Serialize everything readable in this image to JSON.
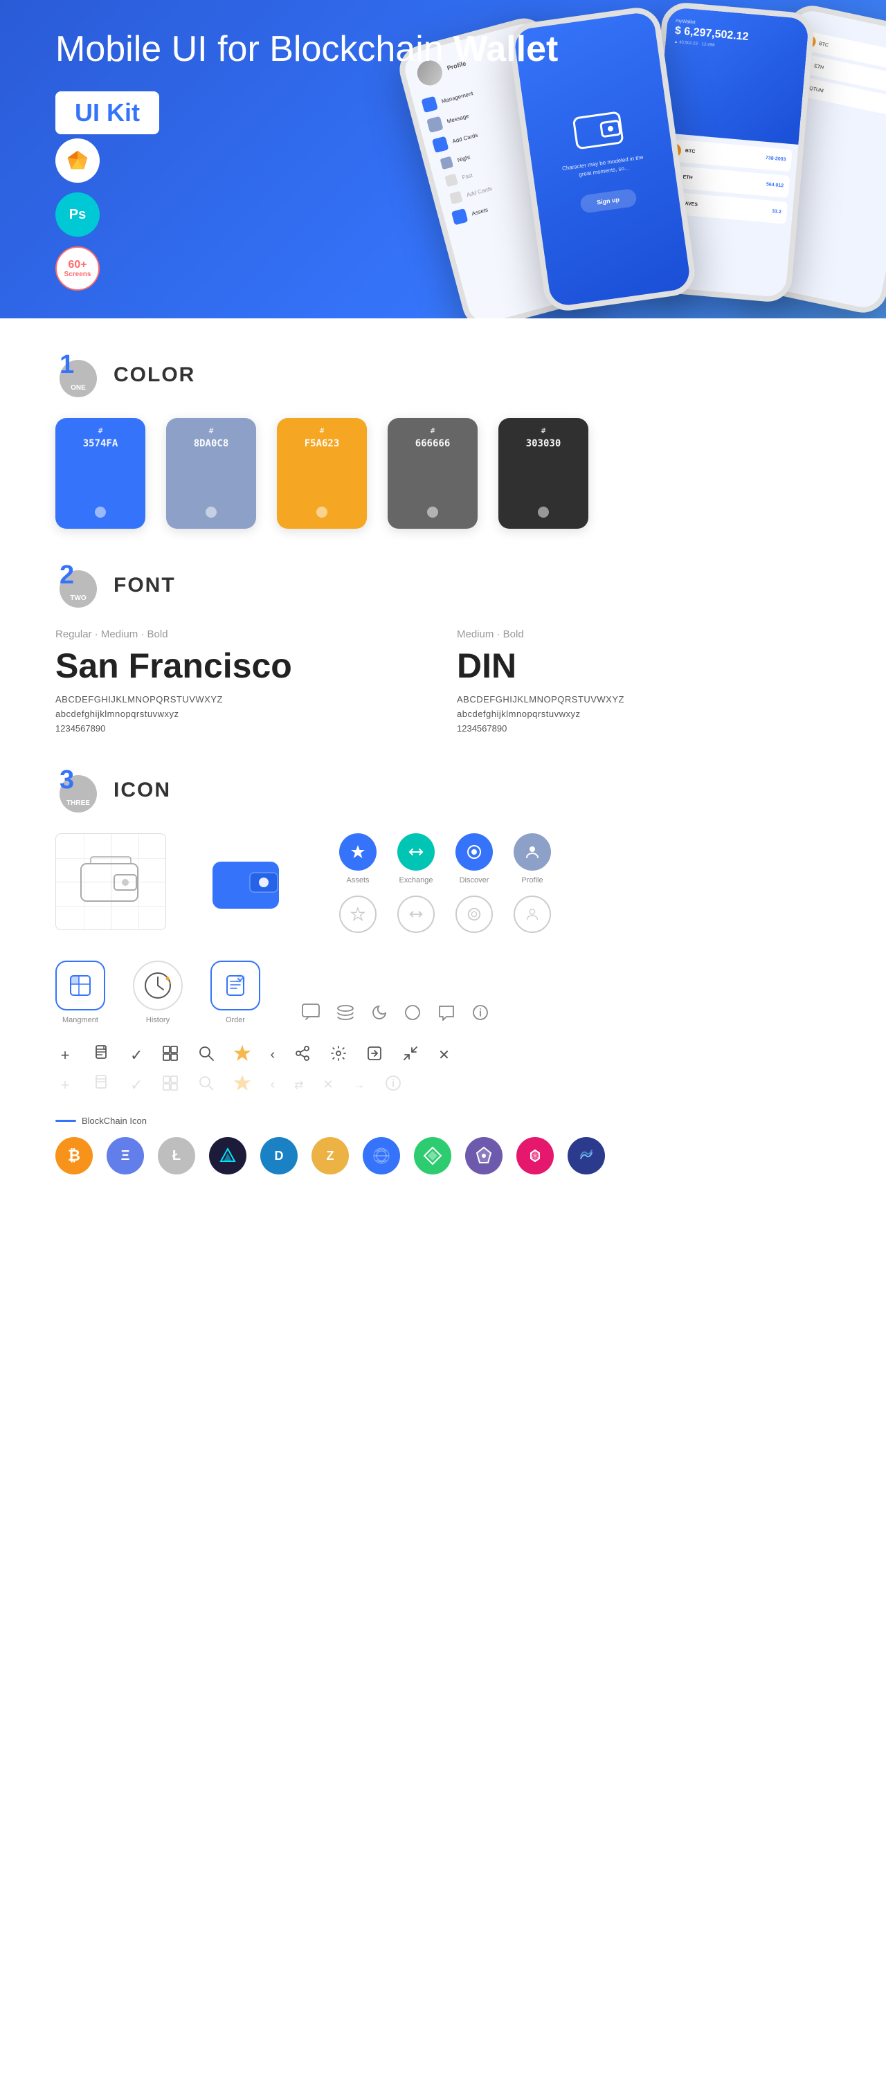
{
  "hero": {
    "title_normal": "Mobile UI for Blockchain ",
    "title_bold": "Wallet",
    "badge": "UI Kit",
    "sketch_label": "Sketch",
    "ps_label": "Ps",
    "screens_label": "60+\nScreens"
  },
  "sections": {
    "color": {
      "number": "1",
      "word": "ONE",
      "title": "COLOR",
      "swatches": [
        {
          "hex": "#3574FA",
          "code": "#",
          "value": "3574FA",
          "bg": "#3574FA"
        },
        {
          "hex": "#8DA0C8",
          "code": "#",
          "value": "8DA0C8",
          "bg": "#8DA0C8"
        },
        {
          "hex": "#F5A623",
          "code": "#",
          "value": "F5A623",
          "bg": "#F5A623"
        },
        {
          "hex": "#666666",
          "code": "#",
          "value": "666666",
          "bg": "#666666"
        },
        {
          "hex": "#303030",
          "code": "#",
          "value": "303030",
          "bg": "#303030"
        }
      ]
    },
    "font": {
      "number": "2",
      "word": "TWO",
      "title": "FONT",
      "font1": {
        "style": "Regular · Medium · Bold",
        "name": "San Francisco",
        "uppercase": "ABCDEFGHIJKLMNOPQRSTUVWXYZ",
        "lowercase": "abcdefghijklmnopqrstuvwxyz",
        "numbers": "1234567890"
      },
      "font2": {
        "style": "Medium · Bold",
        "name": "DIN",
        "uppercase": "ABCDEFGHIJKLMNOPQRSTUVWXYZ",
        "lowercase": "abcdefghijklmnopqrstuvwxyz",
        "numbers": "1234567890"
      }
    },
    "icon": {
      "number": "3",
      "word": "THREE",
      "title": "ICON",
      "nav_icons": [
        {
          "label": "Assets",
          "symbol": "◆"
        },
        {
          "label": "Exchange",
          "symbol": "⇄"
        },
        {
          "label": "Discover",
          "symbol": "●"
        },
        {
          "label": "Profile",
          "symbol": "👤"
        }
      ],
      "app_icons": [
        {
          "label": "Mangment",
          "symbol": "▤"
        },
        {
          "label": "History",
          "symbol": "🕐"
        },
        {
          "label": "Order",
          "symbol": "📋"
        }
      ],
      "tool_symbols_row1": [
        "+",
        "📋",
        "✓",
        "⊞",
        "🔍",
        "☆",
        "<",
        "≺",
        "⚙",
        "⬚",
        "⇄",
        "✕"
      ],
      "blockchain_label": "BlockChain Icon",
      "crypto_icons": [
        {
          "symbol": "₿",
          "bg": "#F7931A",
          "color": "#fff"
        },
        {
          "symbol": "Ξ",
          "bg": "#627EEA",
          "color": "#fff"
        },
        {
          "symbol": "Ł",
          "bg": "#B8B8B8",
          "color": "#fff"
        },
        {
          "symbol": "▲",
          "bg": "#1a1a2e",
          "color": "#00e5ff"
        },
        {
          "symbol": "D",
          "bg": "#1A82C4",
          "color": "#fff"
        },
        {
          "symbol": "Z",
          "bg": "#ECB244",
          "color": "#fff"
        },
        {
          "symbol": "⬡",
          "bg": "#4080ff",
          "color": "#fff"
        },
        {
          "symbol": "△",
          "bg": "#1db954",
          "color": "#fff"
        },
        {
          "symbol": "◈",
          "bg": "#6e5aad",
          "color": "#fff"
        },
        {
          "symbol": "⬦",
          "bg": "#E5186D",
          "color": "#fff"
        },
        {
          "symbol": "~",
          "bg": "#3a3a8c",
          "color": "#6fbcf0"
        }
      ]
    }
  }
}
